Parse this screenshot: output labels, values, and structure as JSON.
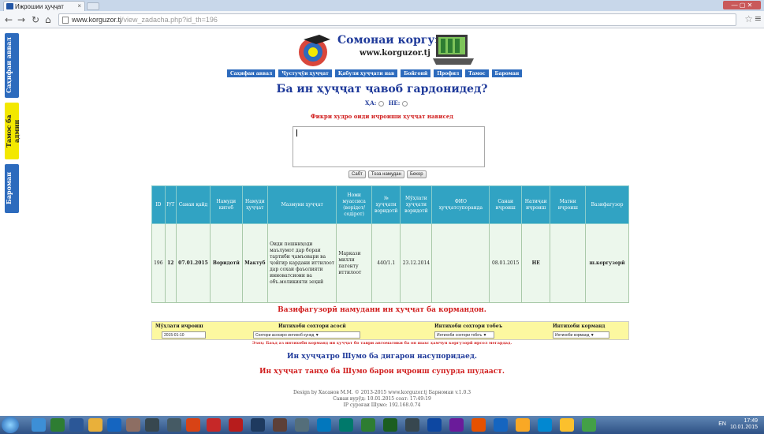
{
  "browser": {
    "tab_title": "Ижрошии ҳуҷҷат",
    "tab_close": "×",
    "url_host": "www.korguzor.tj",
    "url_path": "/view_zadacha.php?id_th=196",
    "window_controls": "— ▢ ✕"
  },
  "left_tabs": [
    "Саҳифаи аввал",
    "Тамос ба админ",
    "Бароман"
  ],
  "site": {
    "title": "Сомонаи коргузорӣ",
    "url": "www.korguzor.tj"
  },
  "nav": [
    "Саҳифаи аввал",
    "Ҷустуҷӯи ҳуҷҷат",
    "Қабули ҳуҷҷати нав",
    "Бойгонӣ",
    "Профил",
    "Тамос",
    "Бароман"
  ],
  "question": "Ба ин ҳуҷҷат ҷавоб гардонидед?",
  "yes_label": "ҲА:",
  "no_label": "НЕ:",
  "hint": "Фикри худро оиди иҷроиши ҳуҷҷат нависед",
  "buttons": {
    "save": "Сабт",
    "new": "Тоза намудан",
    "cancel": "Бекор"
  },
  "table": {
    "headers": [
      "ID",
      "P/T",
      "Санаи қайд",
      "Намуди китоб",
      "Намуди ҳуҷҷат",
      "Мазмуни ҳуҷҷат",
      "Номи муассиса (ворідот/ содірот)",
      "№ ҳуҷҷати воридотӣ",
      "Мӯҳлати ҳуҷҷати воридотӣ",
      "ФИО ҳуҷҷатсупоранда",
      "Санаи иҷроиш",
      "Натиҷаи иҷроиш",
      "Матни иҷроиш",
      "Вазифагузор"
    ],
    "row": [
      "196",
      "12",
      "07.01.2015",
      "Воридотӣ",
      "Мактуб",
      "Оиди пешниҳоди маълумот дар бораи тартиби ҷамъовари ва ҷойгир кардани иттилоот дар сохаи фаъолияти инноватсиони ва объ.моликияти зеҳнӣ",
      "Маркази милли патенту иттилоот",
      "440/1.1",
      "23.12.2014",
      "",
      "08.01.2015",
      "НЕ",
      "",
      "ш.коргузорӣ"
    ]
  },
  "assign_title": "Вазифагузорӣ намудани ин ҳуҷҷат ба кормандон.",
  "filters": {
    "deadline_label": "Мӯҳлати иҷроиш",
    "deadline_value": "2015-01-10",
    "main_label": "Интихоби сохтори асосӣ",
    "main_value": "Сохтори асосиро интихоб кунед   ▼",
    "sub_label": "Интихоби сохтори тобеъ",
    "sub_value": "Интихоби сохтори тобеъ ▼",
    "emp_label": "Интихоби корманд",
    "emp_value": "Интихоби корманд ▼"
  },
  "note": "Эзоҳ: Баъд аз интихоби корманд ин ҳуҷҷат бо таври автоматики ба он шахс ҳамчун коргузорӣ ирсол мегардад.",
  "msg_not_assigned": "Ин ҳуҷҷатро Шумо ба дигарон насупоридаед.",
  "msg_not_only": "Ин ҳуҷҷат танҳо ба Шумо барои иҷроиш супурда шудааст.",
  "footer": [
    "Design by Хасанов М.М. © 2013-2015 www.korguzor.tj Барномаи v.1.0.3",
    "Санаи вурӯд: 10.01.2015 соат: 17:49:19",
    "IP суроғаи Шумо: 192.168.0.74"
  ],
  "tray": {
    "lang": "EN",
    "time": "17:49",
    "date": "10.01.2015"
  },
  "colors": {
    "accent": "#2d6bbd",
    "title": "#1f3a9a",
    "alert": "#d12020",
    "header_cell": "#31a3c3",
    "row_bg": "#ecf7ec",
    "filter_bg": "#fcf8a0"
  }
}
